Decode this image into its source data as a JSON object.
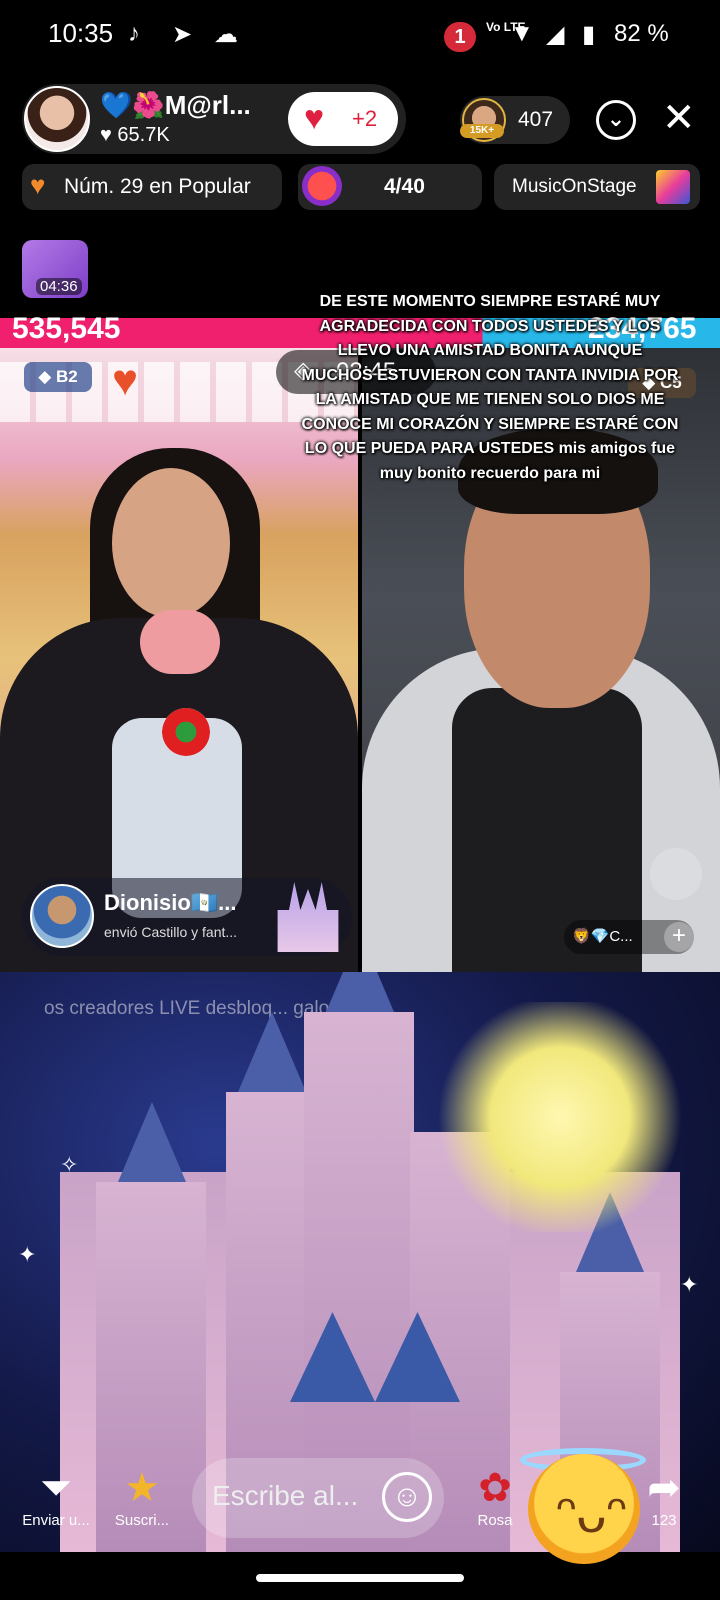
{
  "status_bar": {
    "time": "10:35",
    "notification_count": "1",
    "network": "Vo LTE",
    "battery": "82 %"
  },
  "host": {
    "name": "💙🌺M@rl...",
    "likes": "♥ 65.7K",
    "like_button_count": "+2"
  },
  "viewers": {
    "badge": "15K+",
    "count": "407"
  },
  "chips": {
    "rank": "Núm. 29 en Popular",
    "goal": "4/40",
    "stage": "MusicOnStage"
  },
  "treasure": {
    "timer": "04:36"
  },
  "battle": {
    "score_left": "535,545",
    "score_right": "234,765",
    "timer": "03:45",
    "badge_left": "B2",
    "badge_right": "C5",
    "left_share": 0.67
  },
  "caption": "DE ESTE MOMENTO SIEMPRE ESTARÉ MUY AGRADECIDA CON TODOS USTEDES Y LOS LLEVO UNA AMISTAD BONITA AUNQUE MUCHOS ESTUVIERON CON TANTA INVIDIA POR LA AMISTAD QUE ME TIENEN SOLO DIOS ME CONOCE MI CORAZÓN Y SIEMPRE ESTARÉ CON LO QUE PUEDA PARA USTEDES mis amigos fue muy bonito recuerdo para mi",
  "gift": {
    "sender": "Dionisio🇬🇹...",
    "message": "envió Castillo y fant..."
  },
  "right_chip": "🦁💎C...",
  "promo_text": "os creadores LIVE desbloq...                      galo por al...",
  "toolbar": {
    "send_label": "Enviar u...",
    "subscribe_label": "Suscri...",
    "comment_placeholder": "Escribe al...",
    "rose_label": "Rosa",
    "share_count": "123"
  },
  "colors": {
    "battle_left": "#f0206e",
    "battle_right": "#27b7e8",
    "like_heart": "#e02040"
  }
}
